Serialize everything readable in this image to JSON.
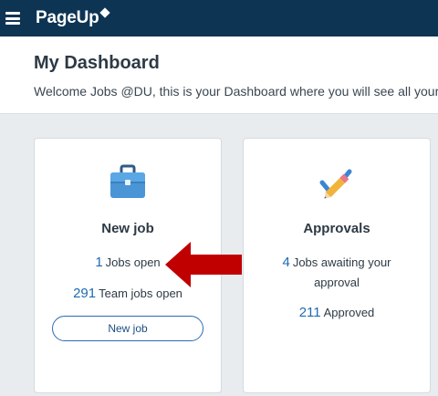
{
  "topbar": {
    "brand": "PageUp",
    "menu_icon": "hamburger-menu-icon",
    "brand_icon": "diamond-logo-icon",
    "color": "#0e3454"
  },
  "header": {
    "title": "My Dashboard",
    "welcome": "Welcome Jobs @DU, this is your Dashboard where you will see all your"
  },
  "cards": {
    "new_job": {
      "icon": "briefcase-icon",
      "title": "New job",
      "jobs_open_count": "1",
      "jobs_open_label": "Jobs open",
      "team_jobs_count": "291",
      "team_jobs_label": "Team jobs open",
      "button_label": "New job"
    },
    "approvals": {
      "icon": "pencil-check-icon",
      "title": "Approvals",
      "awaiting_count": "4",
      "awaiting_label_line1": "Jobs awaiting your",
      "awaiting_label_line2": "approval",
      "approved_count": "211",
      "approved_label": "Approved"
    }
  },
  "annotation": {
    "icon": "red-arrow-left-icon",
    "color": "#c00000"
  },
  "colors": {
    "link": "#1f6ab0",
    "background": "#e9ecef",
    "button_border": "#2b6cb0"
  }
}
